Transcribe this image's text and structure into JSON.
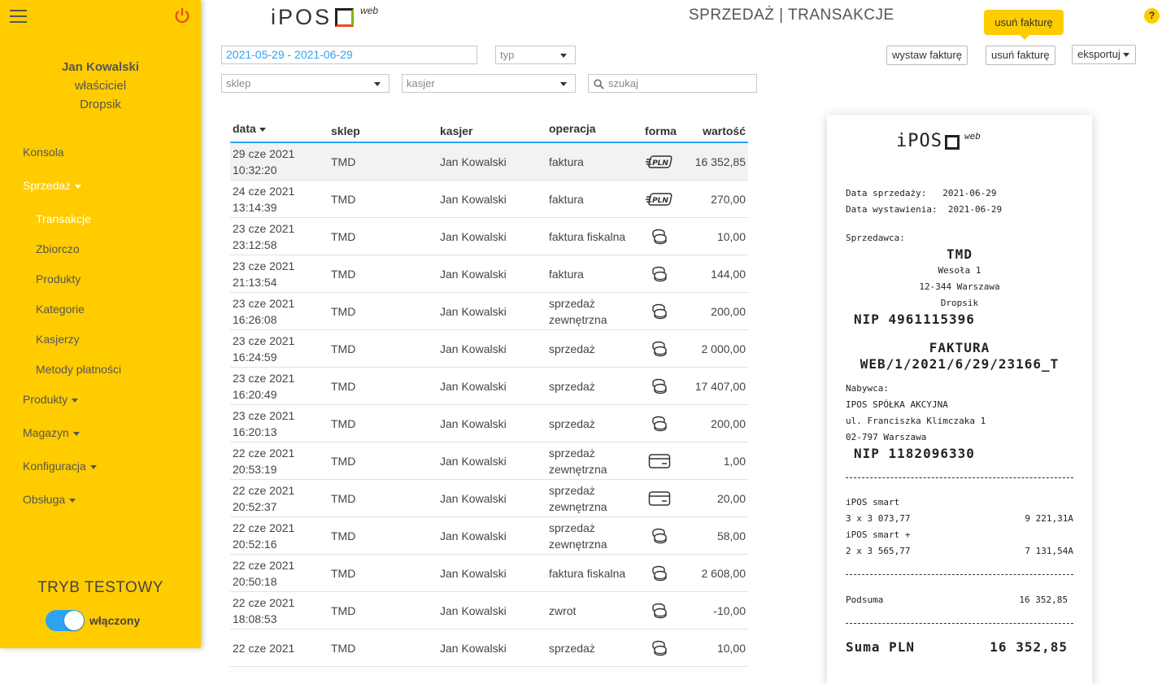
{
  "sidebar": {
    "user_name": "Jan Kowalski",
    "user_role": "właściciel",
    "user_shop": "Dropsik",
    "items": [
      {
        "label": "Konsola"
      },
      {
        "label": "Sprzedaż"
      },
      {
        "label": "Transakcje"
      },
      {
        "label": "Zbiorczo"
      },
      {
        "label": "Produkty"
      },
      {
        "label": "Kategorie"
      },
      {
        "label": "Kasjerzy"
      },
      {
        "label": "Metody płatności"
      },
      {
        "label": "Produkty"
      },
      {
        "label": "Magazyn"
      },
      {
        "label": "Konfiguracja"
      },
      {
        "label": "Obsługa"
      }
    ],
    "test_mode_label": "TRYB TESTOWY",
    "toggle_label": "włączony"
  },
  "header": {
    "logo_text": "iPOS",
    "logo_web": "web",
    "title": "SPRZEDAŻ | TRANSAKCJE",
    "help": "?"
  },
  "filters": {
    "date_range": "2021-05-29 - 2021-06-29",
    "type_placeholder": "typ",
    "shop_placeholder": "sklep",
    "cashier_placeholder": "kasjer",
    "search_placeholder": "szukaj"
  },
  "actions": {
    "issue_invoice": "wystaw fakturę",
    "delete_invoice": "usuń fakturę",
    "export": "eksportuj",
    "tooltip": "usuń fakturę"
  },
  "table": {
    "headers": {
      "date": "data",
      "shop": "sklep",
      "cashier": "kasjer",
      "operation": "operacja",
      "form": "forma",
      "value": "wartość"
    },
    "rows": [
      {
        "d1": "29 cze 2021",
        "d2": "10:32:20",
        "shop": "TMD",
        "cashier": "Jan Kowalski",
        "op1": "faktura",
        "op2": "",
        "form": "transfer-pln-icon",
        "value": "16 352,85"
      },
      {
        "d1": "24 cze 2021",
        "d2": "13:14:39",
        "shop": "TMD",
        "cashier": "Jan Kowalski",
        "op1": "faktura",
        "op2": "",
        "form": "transfer-pln-icon",
        "value": "270,00"
      },
      {
        "d1": "23 cze 2021",
        "d2": "23:12:58",
        "shop": "TMD",
        "cashier": "Jan Kowalski",
        "op1": "faktura fiskalna",
        "op2": "",
        "form": "coins-icon",
        "value": "10,00"
      },
      {
        "d1": "23 cze 2021",
        "d2": "21:13:54",
        "shop": "TMD",
        "cashier": "Jan Kowalski",
        "op1": "faktura",
        "op2": "",
        "form": "coins-icon",
        "value": "144,00"
      },
      {
        "d1": "23 cze 2021",
        "d2": "16:26:08",
        "shop": "TMD",
        "cashier": "Jan Kowalski",
        "op1": "sprzedaż",
        "op2": "zewnętrzna",
        "form": "coins-icon",
        "value": "200,00"
      },
      {
        "d1": "23 cze 2021",
        "d2": "16:24:59",
        "shop": "TMD",
        "cashier": "Jan Kowalski",
        "op1": "sprzedaż",
        "op2": "",
        "form": "coins-icon",
        "value": "2 000,00"
      },
      {
        "d1": "23 cze 2021",
        "d2": "16:20:49",
        "shop": "TMD",
        "cashier": "Jan Kowalski",
        "op1": "sprzedaż",
        "op2": "",
        "form": "coins-icon",
        "value": "17 407,00"
      },
      {
        "d1": "23 cze 2021",
        "d2": "16:20:13",
        "shop": "TMD",
        "cashier": "Jan Kowalski",
        "op1": "sprzedaż",
        "op2": "",
        "form": "coins-icon",
        "value": "200,00"
      },
      {
        "d1": "22 cze 2021",
        "d2": "20:53:19",
        "shop": "TMD",
        "cashier": "Jan Kowalski",
        "op1": "sprzedaż",
        "op2": "zewnętrzna",
        "form": "card-icon",
        "value": "1,00"
      },
      {
        "d1": "22 cze 2021",
        "d2": "20:52:37",
        "shop": "TMD",
        "cashier": "Jan Kowalski",
        "op1": "sprzedaż",
        "op2": "zewnętrzna",
        "form": "card-icon",
        "value": "20,00"
      },
      {
        "d1": "22 cze 2021",
        "d2": "20:52:16",
        "shop": "TMD",
        "cashier": "Jan Kowalski",
        "op1": "sprzedaż",
        "op2": "zewnętrzna",
        "form": "coins-icon",
        "value": "58,00"
      },
      {
        "d1": "22 cze 2021",
        "d2": "20:50:18",
        "shop": "TMD",
        "cashier": "Jan Kowalski",
        "op1": "faktura fiskalna",
        "op2": "",
        "form": "coins-icon",
        "value": "2 608,00"
      },
      {
        "d1": "22 cze 2021",
        "d2": "18:08:53",
        "shop": "TMD",
        "cashier": "Jan Kowalski",
        "op1": "zwrot",
        "op2": "",
        "form": "coins-icon",
        "value": "-10,00"
      },
      {
        "d1": "22 cze 2021",
        "d2": "",
        "shop": "TMD",
        "cashier": "Jan Kowalski",
        "op1": "sprzedaż",
        "op2": "",
        "form": "coins-icon",
        "value": "10,00"
      }
    ]
  },
  "receipt": {
    "logo_text": "iPOS",
    "logo_web": "web",
    "sale_date_label": "Data sprzedaży:",
    "sale_date": "2021-06-29",
    "issue_date_label": "Data wystawienia:",
    "issue_date": "2021-06-29",
    "seller_label": "Sprzedawca:",
    "seller_name": "TMD",
    "seller_addr1": "Wesoła 1",
    "seller_addr2": "12-344 Warszawa",
    "seller_addr3": "Dropsik",
    "seller_nip": "NIP 4961115396",
    "doc_type": "FAKTURA",
    "doc_number": "WEB/1/2021/6/29/23166_T",
    "buyer_label": "Nabywca:",
    "buyer_name": "IPOS SPÓŁKA AKCYJNA",
    "buyer_addr1": "ul. Franciszka Klimczaka 1",
    "buyer_addr2": "02-797 Warszawa",
    "buyer_nip": "NIP 1182096330",
    "item1_name": "iPOS smart",
    "item1_qty": "3 x 3 073,77",
    "item1_total": "9 221,31A",
    "item2_name": "iPOS smart +",
    "item2_qty": "2 x 3 565,77",
    "item2_total": "7 131,54A",
    "subtotal_label": "Podsuma",
    "subtotal": "16 352,85",
    "total_label": "Suma PLN",
    "total": "16 352,85"
  },
  "colors": {
    "sidebar": "#ffcc00",
    "accent": "#2ea3f2"
  }
}
